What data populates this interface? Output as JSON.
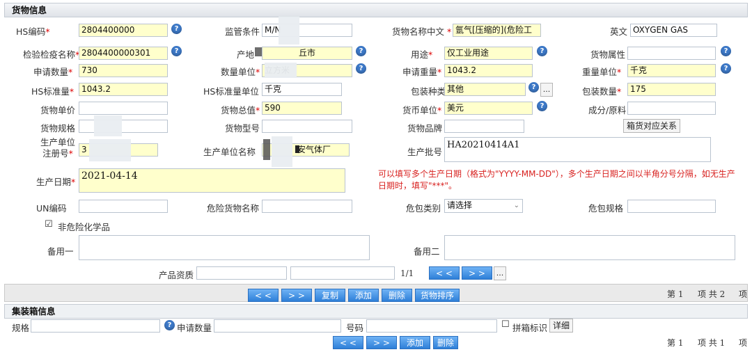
{
  "goods_info": {
    "title": "货物信息"
  },
  "row1": {
    "hs_code_label": "HS编码",
    "hs_code": "2804400000",
    "supervision_label": "监管条件",
    "supervision_value": "M/N",
    "cn_name_label": "货物名称中文",
    "cn_name": "氩气[压缩的](危险工",
    "en_label": "英文",
    "en_name": "OXYGEN GAS"
  },
  "row2": {
    "inspection_name_label": "检验检疫名称",
    "inspection_name": "2804400000301",
    "origin_label": "产地",
    "origin_value": "丘市",
    "use_label": "用途",
    "use_value": "仅工业用途",
    "attr_label": "货物属性",
    "attr_value": ""
  },
  "row3": {
    "apply_qty_label": "申请数量",
    "apply_qty": "730",
    "qty_unit_label": "数量单位",
    "qty_unit": "立方米",
    "apply_weight_label": "申请重量",
    "apply_weight": "1043.2",
    "weight_unit_label": "重量单位",
    "weight_unit": "千克"
  },
  "row4": {
    "hs_std_qty_label": "HS标准量",
    "hs_std_qty": "1043.2",
    "hs_std_unit_label": "HS标准量单位",
    "hs_std_unit": "千克",
    "pack_type_label": "包装种类",
    "pack_type": "其他",
    "ellipsis": "...",
    "pack_count_label": "包装数量",
    "pack_count": "175"
  },
  "row5": {
    "unit_price_label": "货物单价",
    "unit_price": "",
    "total_label": "货物总值",
    "total_value": "590",
    "currency_label": "货币单位",
    "currency": "美元",
    "material_label": "成分/原料",
    "material": ""
  },
  "row6": {
    "spec_label": "货物规格",
    "spec": "",
    "model_label": "货物型号",
    "model": "",
    "brand_label": "货物品牌",
    "brand": "",
    "box_relation_button": "箱货对应关系"
  },
  "row7": {
    "producer_reg_label_1": "生产单位",
    "producer_reg_label_2": "注册号",
    "producer_reg": "3",
    "producer_name_label": "生产单位名称",
    "producer_name": "安气体厂",
    "batch_label": "生产批号",
    "batch_value": "HA20210414A1"
  },
  "row8": {
    "prod_date_label": "生产日期",
    "prod_date": "2021-04-14",
    "hint": "可以填写多个生产日期（格式为\"YYYY-MM-DD\"），多个生产日期之间以半角分号分隔，如无生产日期时，填写\"***\"。"
  },
  "row9": {
    "un_label": "UN编码",
    "un_value": "",
    "danger_name_label": "危险货物名称",
    "danger_name": "",
    "danger_pack_label": "危包类别",
    "danger_pack_value": "请选择",
    "danger_spec_label": "危包规格",
    "danger_spec": ""
  },
  "row10": {
    "non_danger_checkbox": "☑",
    "non_danger_label": "非危险化学品"
  },
  "row11": {
    "spare1_label": "备用一",
    "spare1": "",
    "spare2_label": "备用二",
    "spare2": ""
  },
  "row12": {
    "qual_label": "产品资质",
    "qual_value1": "",
    "qual_value2": "",
    "page_indicator": "1/1",
    "prev": "< <",
    "next": "> >",
    "ellipsis": "..."
  },
  "toolbar1": {
    "prev": "< <",
    "next": "> >",
    "copy": "复制",
    "add": "添加",
    "delete": "删除",
    "sort": "货物排序",
    "page_text": "第 1",
    "total_text": "项 共 2",
    "item_text": "项"
  },
  "container_info": {
    "title": "集装箱信息",
    "spec_label": "规格",
    "spec": "",
    "apply_qty_label": "申请数量",
    "apply_qty": "",
    "number_label": "号码",
    "number": "",
    "merge_checkbox": "☐",
    "merge_label": "拼箱标识",
    "detail_button": "详细"
  },
  "toolbar2": {
    "prev": "< <",
    "next": "> >",
    "add": "添加",
    "delete": "删除",
    "page_text": "第 1",
    "total_text": "项 共 1",
    "item_text": "项"
  },
  "colors": {
    "accent": "#2e7fd8",
    "input_yellow": "#ffffcc",
    "hint_red": "#d8211f"
  }
}
